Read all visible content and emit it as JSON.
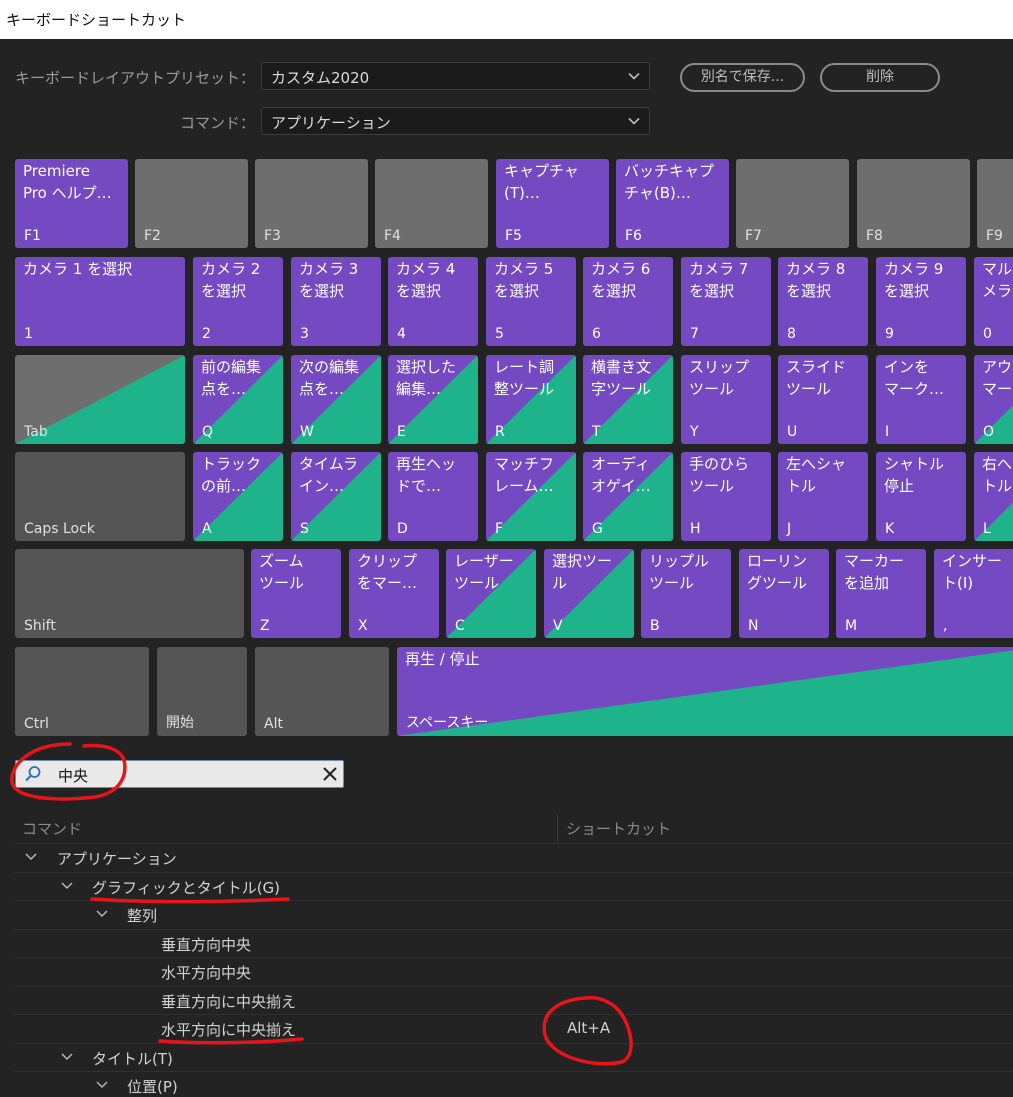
{
  "window": {
    "title": "キーボードショートカット"
  },
  "preset": {
    "label": "キーボードレイアウトプリセット：",
    "value": "カスタム2020"
  },
  "command": {
    "label": "コマンド：",
    "value": "アプリケーション"
  },
  "buttons": {
    "save_as": "別名で保存...",
    "delete": "削除"
  },
  "keys": {
    "f1": {
      "cmd": "Premiere\nPro ヘルプ…",
      "key": "F1"
    },
    "f2": {
      "cmd": "",
      "key": "F2"
    },
    "f3": {
      "cmd": "",
      "key": "F3"
    },
    "f4": {
      "cmd": "",
      "key": "F4"
    },
    "f5": {
      "cmd": "キャプチャ\n(T)…",
      "key": "F5"
    },
    "f6": {
      "cmd": "バッチキャプ\nチャ(B)…",
      "key": "F6"
    },
    "f7": {
      "cmd": "",
      "key": "F7"
    },
    "f8": {
      "cmd": "",
      "key": "F8"
    },
    "f9": {
      "cmd": "",
      "key": "F9"
    },
    "k1": {
      "cmd": "カメラ 1 を選択",
      "key": "1"
    },
    "k2": {
      "cmd": "カメラ 2\nを選択",
      "key": "2"
    },
    "k3": {
      "cmd": "カメラ 3\nを選択",
      "key": "3"
    },
    "k4": {
      "cmd": "カメラ 4\nを選択",
      "key": "4"
    },
    "k5": {
      "cmd": "カメラ 5\nを選択",
      "key": "5"
    },
    "k6": {
      "cmd": "カメラ 6\nを選択",
      "key": "6"
    },
    "k7": {
      "cmd": "カメラ 7\nを選択",
      "key": "7"
    },
    "k8": {
      "cmd": "カメラ 8\nを選択",
      "key": "8"
    },
    "k9": {
      "cmd": "カメラ 9\nを選択",
      "key": "9"
    },
    "k0": {
      "cmd": "マル\nメラ",
      "key": "0"
    },
    "tab": {
      "cmd": "",
      "key": "Tab"
    },
    "q": {
      "cmd": "前の編集\n点を…",
      "key": "Q"
    },
    "w": {
      "cmd": "次の編集\n点を…",
      "key": "W"
    },
    "e": {
      "cmd": "選択した\n編集…",
      "key": "E"
    },
    "r": {
      "cmd": "レート調\n整ツール",
      "key": "R"
    },
    "t": {
      "cmd": "横書き文\n字ツール",
      "key": "T"
    },
    "y": {
      "cmd": "スリップ\nツール",
      "key": "Y"
    },
    "u": {
      "cmd": "スライド\nツール",
      "key": "U"
    },
    "i": {
      "cmd": "インを\nマーク…",
      "key": "I"
    },
    "o": {
      "cmd": "アウ\nマー",
      "key": "O"
    },
    "caps": {
      "cmd": "",
      "key": "Caps Lock"
    },
    "a": {
      "cmd": "トラック\nの前…",
      "key": "A"
    },
    "s": {
      "cmd": "タイムラ\nイン…",
      "key": "S"
    },
    "d": {
      "cmd": "再生ヘッ\nドで…",
      "key": "D"
    },
    "f": {
      "cmd": "マッチフ\nレーム…",
      "key": "F"
    },
    "g": {
      "cmd": "オーディ\nオゲイ…",
      "key": "G"
    },
    "h": {
      "cmd": "手のひら\nツール",
      "key": "H"
    },
    "j": {
      "cmd": "左へシャ\nトル",
      "key": "J"
    },
    "k": {
      "cmd": "シャトル\n停止",
      "key": "K"
    },
    "l": {
      "cmd": "右へ\nトル",
      "key": "L"
    },
    "shift": {
      "cmd": "",
      "key": "Shift"
    },
    "z": {
      "cmd": "ズーム\nツール",
      "key": "Z"
    },
    "x": {
      "cmd": "クリップ\nをマー…",
      "key": "X"
    },
    "c": {
      "cmd": "レーザー\nツール",
      "key": "C"
    },
    "v": {
      "cmd": "選択ツー\nル",
      "key": "V"
    },
    "b": {
      "cmd": "リップル\nツール",
      "key": "B"
    },
    "n": {
      "cmd": "ローリン\nグツール",
      "key": "N"
    },
    "m": {
      "cmd": "マーカー\nを追加",
      "key": "M"
    },
    "comma": {
      "cmd": "インサー\nト(I)",
      "key": ","
    },
    "ctrl": {
      "cmd": "",
      "key": "Ctrl"
    },
    "start": {
      "cmd": "",
      "key": "開始"
    },
    "alt": {
      "cmd": "",
      "key": "Alt"
    },
    "space": {
      "cmd": "再生 / 停止",
      "key": "スペースキー"
    }
  },
  "search": {
    "value": "中央"
  },
  "columns": {
    "command": "コマンド",
    "shortcut": "ショートカット"
  },
  "tree": [
    {
      "level": 0,
      "expanded": true,
      "label": "アプリケーション",
      "shortcut": ""
    },
    {
      "level": 1,
      "expanded": true,
      "label": "グラフィックとタイトル(G)",
      "shortcut": ""
    },
    {
      "level": 2,
      "expanded": true,
      "label": "整列",
      "shortcut": ""
    },
    {
      "level": 3,
      "expanded": null,
      "label": "垂直方向中央",
      "shortcut": ""
    },
    {
      "level": 3,
      "expanded": null,
      "label": "水平方向中央",
      "shortcut": ""
    },
    {
      "level": 3,
      "expanded": null,
      "label": "垂直方向に中央揃え",
      "shortcut": ""
    },
    {
      "level": 3,
      "expanded": null,
      "label": "水平方向に中央揃え",
      "shortcut": "Alt+A"
    },
    {
      "level": 1,
      "expanded": true,
      "label": "タイトル(T)",
      "shortcut": ""
    },
    {
      "level": 2,
      "expanded": true,
      "label": "位置(P)",
      "shortcut": ""
    }
  ],
  "colors": {
    "assigned": "#7449c2",
    "partial": "#1eb38a",
    "unassigned": "#6e6e6e",
    "modifier": "#555555",
    "annotation": "#e8141a"
  }
}
